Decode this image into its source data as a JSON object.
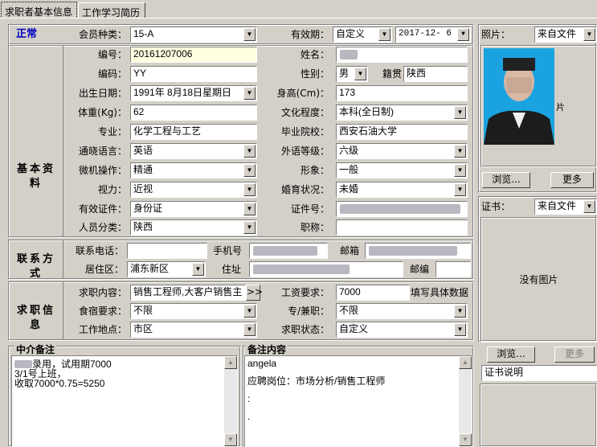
{
  "tabs": [
    {
      "label": "求职者基本信息",
      "active": true
    },
    {
      "label": "工作学习简历",
      "active": false
    }
  ],
  "header": {
    "status": "正常",
    "member_type_label": "会员种类：",
    "member_type_value": "15-A",
    "validity_label": "有效期：",
    "validity_mode": "自定义",
    "validity_date": "2017-12- 6"
  },
  "basic": {
    "section_title": "基本资料",
    "id_no_label": "编号：",
    "id_no_value": "20161207006",
    "name_label": "姓名：",
    "code_label": "编码：",
    "code_value": "YY",
    "gender_label": "性别：",
    "gender_value": "男",
    "hometown_label": "籍贯",
    "hometown_value": "陕西",
    "birth_label": "出生日期：",
    "birth_value": "1991年 8月18日星期日",
    "height_label": "身高(Cm)：",
    "height_value": "173",
    "weight_label": "体重(Kg)：",
    "weight_value": "62",
    "education_label": "文化程度：",
    "education_value": "本科(全日制)",
    "major_label": "专业：",
    "major_value": "化学工程与工艺",
    "school_label": "毕业院校：",
    "school_value": "西安石油大学",
    "lang_label": "通晓语言：",
    "lang_value": "英语",
    "lang_level_label": "外语等级：",
    "lang_level_value": "六级",
    "computer_label": "微机操作：",
    "computer_value": "精通",
    "appearance_label": "形象：",
    "appearance_value": "一般",
    "vision_label": "视力：",
    "vision_value": "近视",
    "marital_label": "婚育状况：",
    "marital_value": "未婚",
    "id_doc_label": "有效证件：",
    "id_doc_value": "身份证",
    "cert_no_label": "证件号：",
    "category_label": "人员分类：",
    "category_value": "陕西",
    "title_label": "职称："
  },
  "contact": {
    "section_title": "联系方式",
    "phone_label": "联系电话：",
    "mobile_label": "手机号",
    "email_label": "邮箱",
    "district_label": "居住区：",
    "district_value": "浦东新区",
    "address_label": "住址",
    "zip_label": "邮编"
  },
  "job": {
    "section_title": "求职信息",
    "content_label": "求职内容：",
    "content_value": "销售工程师,大客户销售主",
    "more_btn": ">>",
    "salary_label": "工资要求：",
    "salary_value": "7000",
    "salary_hint": "填写具体数据",
    "lodging_label": "食宿要求：",
    "lodging_value": "不限",
    "parttime_label": "专/兼职：",
    "parttime_value": "不限",
    "location_label": "工作地点：",
    "location_value": "市区",
    "status_label": "求职状态：",
    "status_value": "自定义"
  },
  "agency_note": {
    "title": "中介备注",
    "lines": [
      "录用，试用期7000",
      "3/1号上班，",
      "收取7000*0.75=5250"
    ]
  },
  "remark": {
    "title": "备注内容",
    "lines": [
      "angela",
      "",
      "应聘岗位：市场分析/销售工程师",
      "",
      ":",
      "",
      "."
    ]
  },
  "photo": {
    "label": "照片：",
    "source": "来自文件",
    "browse_btn": "浏览...",
    "more_btn": "更多"
  },
  "certificate": {
    "label": "证书：",
    "source": "来自文件",
    "empty_text": "没有图片",
    "browse_btn": "浏览...",
    "more_btn": "更多",
    "desc_value": "证书说明"
  },
  "colors": {
    "status_blue": "#0000c0",
    "photo_bg": "#1aa3e0",
    "tab_bg": "#d4d0c8"
  }
}
